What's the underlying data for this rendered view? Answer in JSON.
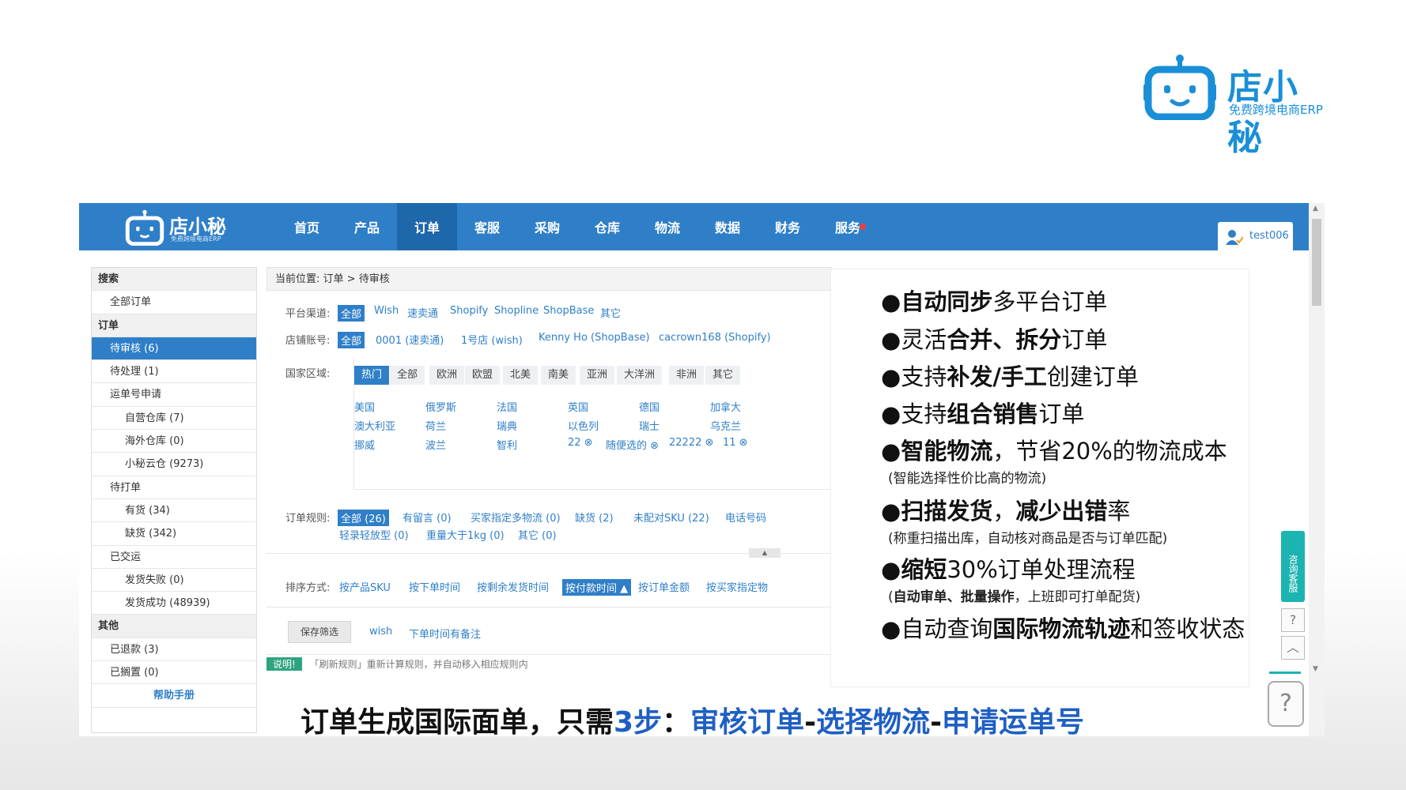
{
  "brand": {
    "name": "店小秘",
    "sub": "免费跨境电商ERP",
    "color": "#1a8fd8"
  },
  "nav": {
    "logo_name": "店小秘",
    "logo_sub": "免费跨境电商ERP",
    "items": [
      "首页",
      "产品",
      "订单",
      "客服",
      "采购",
      "仓库",
      "物流",
      "数据",
      "财务",
      "服务"
    ],
    "active": "订单",
    "user": "test006",
    "color": "#2f7fc8"
  },
  "sidebar": {
    "rows": [
      {
        "label": "搜索",
        "type": "head"
      },
      {
        "label": "全部订单",
        "type": "item"
      },
      {
        "label": "订单",
        "type": "head"
      },
      {
        "label": "待审核 (6)",
        "type": "active"
      },
      {
        "label": "待处理 (1)",
        "type": "item"
      },
      {
        "label": "运单号申请",
        "type": "item"
      },
      {
        "label": "自营仓库 (7)",
        "type": "sub"
      },
      {
        "label": "海外仓库 (0)",
        "type": "sub"
      },
      {
        "label": "小秘云仓 (9273)",
        "type": "sub"
      },
      {
        "label": "待打单",
        "type": "item"
      },
      {
        "label": "有货 (34)",
        "type": "sub"
      },
      {
        "label": "缺货 (342)",
        "type": "sub"
      },
      {
        "label": "已交运",
        "type": "item"
      },
      {
        "label": "发货失败 (0)",
        "type": "sub"
      },
      {
        "label": "发货成功 (48939)",
        "type": "sub"
      },
      {
        "label": "其他",
        "type": "head"
      },
      {
        "label": "已退款 (3)",
        "type": "item"
      },
      {
        "label": "已搁置 (0)",
        "type": "item"
      },
      {
        "label": "帮助手册",
        "type": "help"
      }
    ]
  },
  "main": {
    "crumb_prefix": "当前位置:",
    "crumb": "订单 > 待审核",
    "platform_label": "平台渠道:",
    "platforms": [
      "全部",
      "Wish",
      "速卖通",
      "Shopify",
      "Shopline",
      "ShopBase",
      "其它"
    ],
    "store_label": "店铺账号:",
    "stores": [
      "全部",
      "0001 (速卖通)",
      "1号店 (wish)",
      "Kenny Ho (ShopBase)",
      "cacrown168 (Shopify)"
    ],
    "region_label": "国家区域:",
    "region_tabs": [
      "热门",
      "全部",
      "欧洲",
      "欧盟",
      "北美",
      "南美",
      "亚洲",
      "大洋洲",
      "非洲",
      "其它"
    ],
    "countries": [
      [
        "美国",
        "俄罗斯",
        "法国",
        "英国",
        "德国",
        "加拿大"
      ],
      [
        "澳大利亚",
        "荷兰",
        "瑞典",
        "以色列",
        "瑞士",
        "乌克兰"
      ],
      [
        "挪威",
        "波兰",
        "智利",
        "22 ⊗",
        "随便选的 ⊗",
        "22222 ⊗",
        "11 ⊗"
      ]
    ],
    "rule_label": "订单规则:",
    "rules_row1": [
      "全部 (26)",
      "有留言 (0)",
      "买家指定多物流 (0)",
      "缺货 (2)",
      "未配对SKU (22)",
      "电话号码"
    ],
    "rules_row2": [
      "轻录轻放型 (0)",
      "重量大于1kg (0)",
      "其它 (0)"
    ],
    "sort_label": "排序方式:",
    "sorts": [
      "按产品SKU",
      "按下单时间",
      "按剩余发货时间",
      "按付款时间 ▲",
      "按订单金额",
      "按买家指定物"
    ],
    "save_filter": "保存筛选",
    "saved_filters": [
      "wish",
      "下单时间有备注"
    ],
    "tip_badge": "说明!",
    "tip_text": "「刷新规则」重新计算规则，并自动移入相应规则内"
  },
  "side_widgets": {
    "consult": "咨询客服",
    "help_icon": "question-icon",
    "top_icon": "chevron-up-icon",
    "accent": "#1bb4b0"
  },
  "features": [
    {
      "pre": "",
      "bold": "自动同步",
      "post": "多平台订单"
    },
    {
      "pre": "灵活",
      "bold": "合并、拆分",
      "post": "订单"
    },
    {
      "pre": "支持",
      "bold": "补发/手工",
      "post": "创建订单"
    },
    {
      "pre": "支持",
      "bold": "组合销售",
      "post": "订单"
    },
    {
      "pre": "",
      "bold": "智能物流",
      "post": "，节省20%的物流成本",
      "sub_pre": "(智能选择性价比高的物流)",
      "sub_bold": "",
      "sub_post": ""
    },
    {
      "pre": "",
      "bold": "扫描发货",
      "post": "，",
      "bold2": "减少出错",
      "post2": "率",
      "sub_pre": "(称重扫描出库，自动核对商品是否与订单匹配)",
      "sub_bold": "",
      "sub_post": ""
    },
    {
      "pre": "",
      "bold": "缩短",
      "post": "30%订单处理流程",
      "sub_pre": "(",
      "sub_bold": "自动审单、批量操作",
      "sub_post": "，上班即可打单配货)"
    },
    {
      "pre": "自动查询",
      "bold": "国际物流轨迹",
      "post": "和签收状态"
    }
  ],
  "banner": {
    "part1": "订单生成国际面单，只需",
    "steps": "3步",
    "colon": "：",
    "step1": "审核订单",
    "dash1": "-",
    "step2": "选择物流",
    "dash2": "-",
    "step3": "申请运单号"
  }
}
